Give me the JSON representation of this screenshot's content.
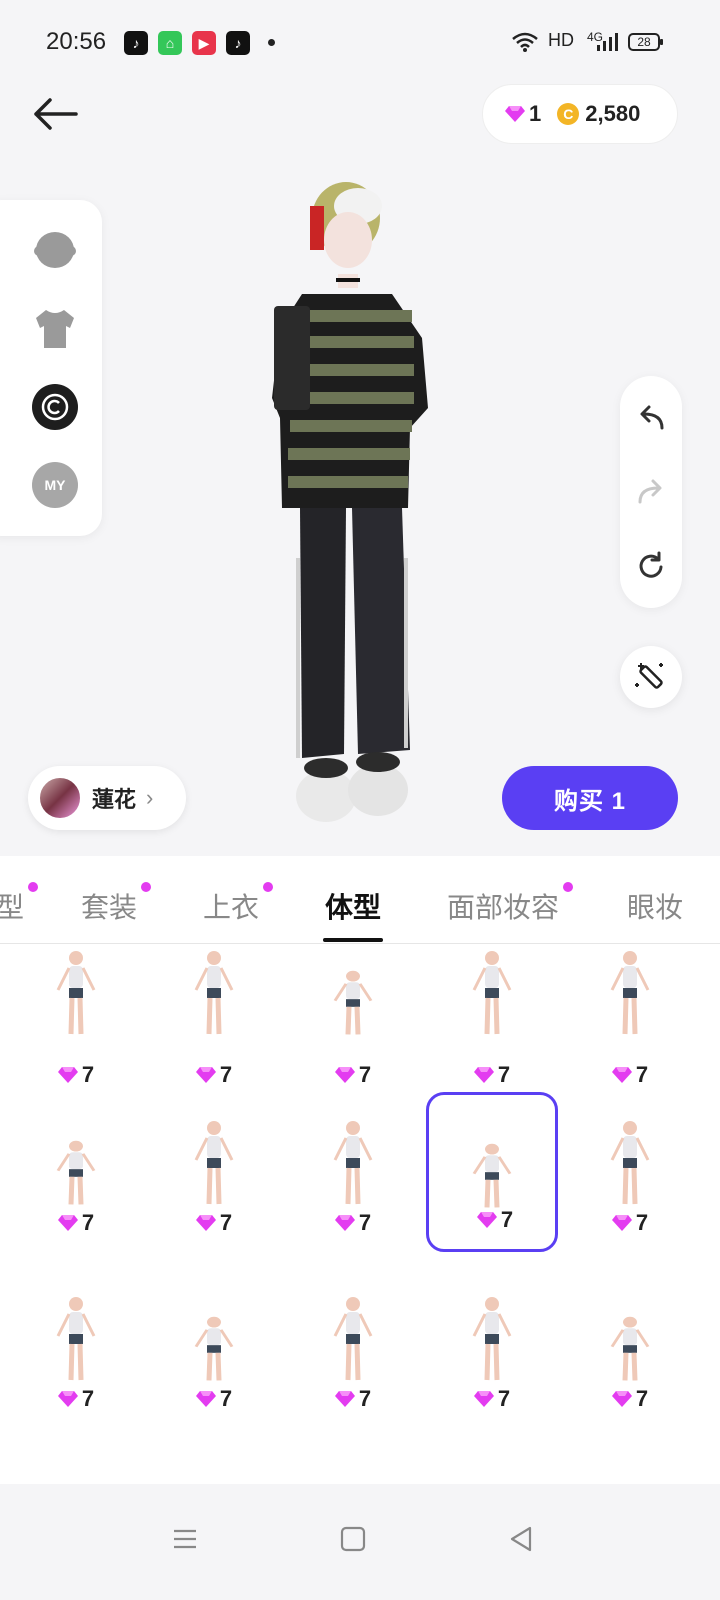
{
  "status_bar": {
    "time": "20:56",
    "network_label": "HD",
    "network_type": "4G",
    "battery": "28"
  },
  "currency": {
    "gems": "1",
    "coins": "2,580"
  },
  "left_tools": [
    "head-icon",
    "shirt-icon",
    "copyright-icon",
    "my-icon"
  ],
  "left_tools_my_label": "MY",
  "profile": {
    "name": "蓮花"
  },
  "buy_button": "购买 1",
  "tabs": [
    {
      "label": "型",
      "dot": true
    },
    {
      "label": "套装",
      "dot": true
    },
    {
      "label": "上衣",
      "dot": true
    },
    {
      "label": "体型",
      "dot": false,
      "active": true
    },
    {
      "label": "面部妆容",
      "dot": true
    },
    {
      "label": "眼妆",
      "dot": false
    }
  ],
  "grid_items": [
    {
      "price": "7"
    },
    {
      "price": "7"
    },
    {
      "price": "7"
    },
    {
      "price": "7"
    },
    {
      "price": "7"
    },
    {
      "price": "7"
    },
    {
      "price": "7"
    },
    {
      "price": "7"
    },
    {
      "price": "7",
      "selected": true
    },
    {
      "price": "7"
    },
    {
      "price": "7"
    },
    {
      "price": "7"
    },
    {
      "price": "7"
    },
    {
      "price": "7"
    },
    {
      "price": "7"
    }
  ],
  "colors": {
    "accent": "#5a3ff3",
    "gem": "#e33cf0",
    "coin": "#f3b526"
  }
}
